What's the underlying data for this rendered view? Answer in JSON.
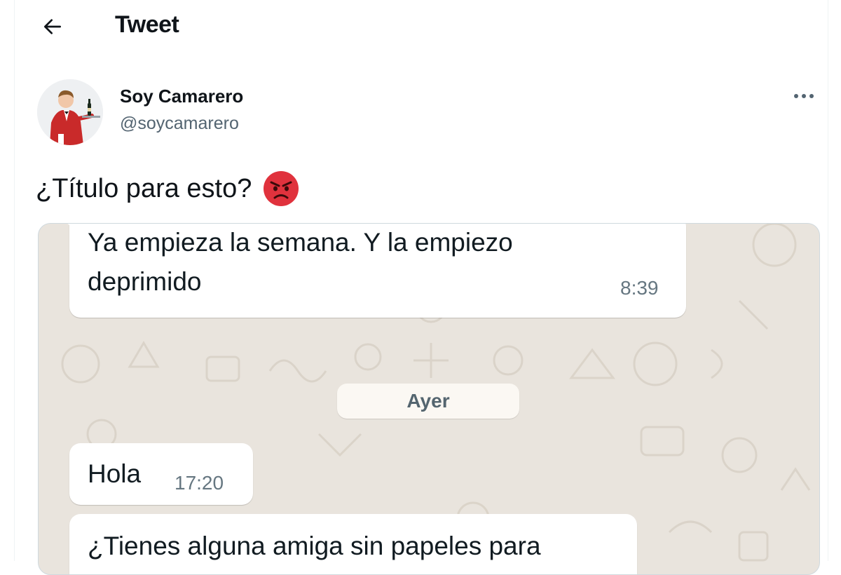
{
  "header": {
    "title": "Tweet"
  },
  "author": {
    "name": "Soy Camarero",
    "handle": "@soycamarero"
  },
  "tweet": {
    "text": "¿Título para esto?"
  },
  "chat": {
    "messages": [
      {
        "text": "Ya empieza la semana. Y la empiezo deprimido",
        "time": "8:39"
      },
      {
        "text": "Hola",
        "time": "17:20"
      },
      {
        "text": "¿Tienes alguna amiga sin papeles para",
        "time": ""
      }
    ],
    "date_separator": "Ayer"
  },
  "icons": {
    "back": "arrow-left-icon",
    "more": "more-horizontal-icon",
    "emoji": "angry-face-emoji"
  },
  "colors": {
    "text": "#0f1419",
    "secondary": "#536471",
    "chat_bg": "#e9e4dd",
    "bubble": "#ffffff"
  }
}
